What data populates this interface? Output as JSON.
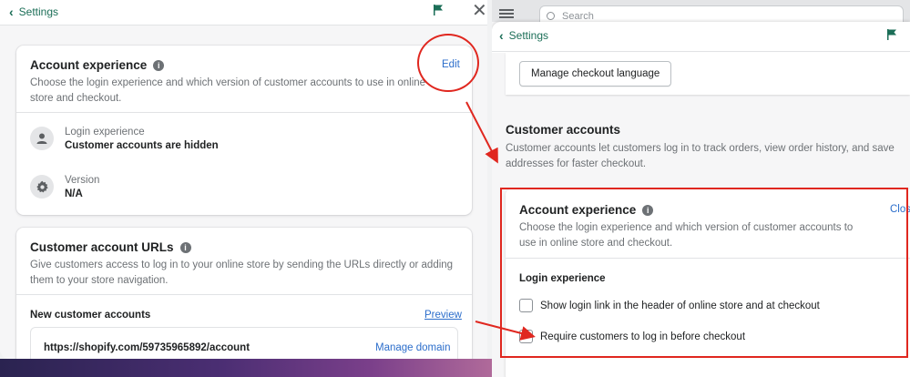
{
  "left_panel": {
    "back_label": "Settings",
    "account_experience": {
      "title": "Account experience",
      "edit_label": "Edit",
      "description": "Choose the login experience and which version of customer accounts to use in online store and checkout.",
      "login_label": "Login experience",
      "login_value": "Customer accounts are hidden",
      "version_label": "Version",
      "version_value": "N/A"
    },
    "account_urls": {
      "title": "Customer account URLs",
      "description": "Give customers access to log in to your online store by sending the URLs directly or adding them to your store navigation.",
      "new_accounts_label": "New customer accounts",
      "preview_label": "Preview",
      "url": "https://shopify.com/59735965892/account",
      "manage_domain_label": "Manage domain"
    }
  },
  "right_panel": {
    "search_placeholder": "Search",
    "back_label": "Settings",
    "manage_checkout_language_label": "Manage checkout language",
    "customer_accounts": {
      "title": "Customer accounts",
      "description": "Customer accounts let customers log in to track orders, view order history, and save addresses for faster checkout."
    },
    "account_experience": {
      "title": "Account experience",
      "close_label": "Close",
      "description": "Choose the login experience and which version of customer accounts to use in online store and checkout.",
      "login_heading": "Login experience",
      "options": [
        {
          "label": "Show login link in the header of online store and at checkout",
          "checked": false
        },
        {
          "label": "Require customers to log in before checkout",
          "checked": false
        }
      ]
    }
  },
  "colors": {
    "accent_green": "#1b6e57",
    "link_blue": "#2c6ecb",
    "annotation_red": "#e0271f"
  }
}
